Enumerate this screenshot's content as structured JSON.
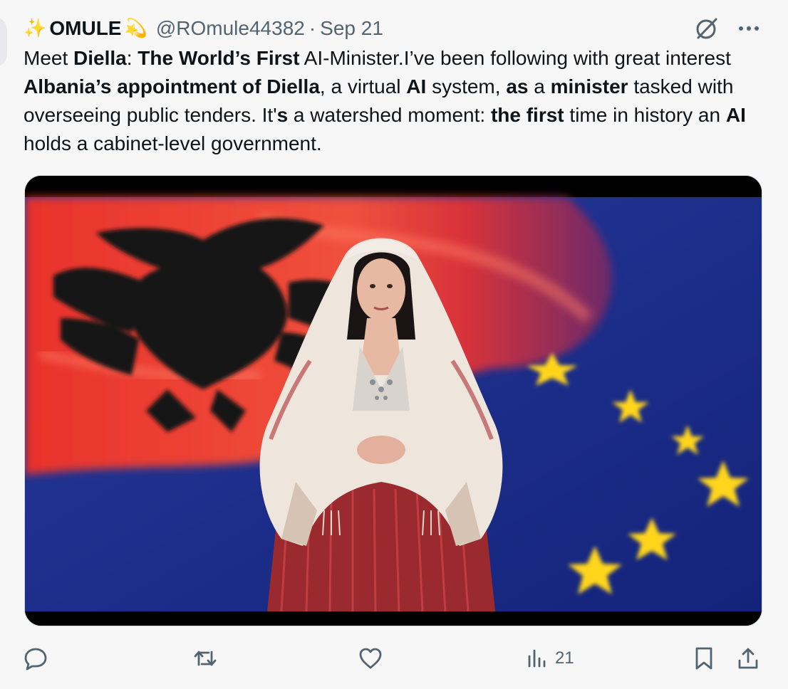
{
  "tweet": {
    "display_name": "OMULE",
    "name_emoji_left": "✨",
    "name_emoji_right": "💫",
    "handle": "@ROmule44382",
    "separator": "·",
    "date": "Sep 21",
    "text": {
      "s1": "Meet ",
      "b1": "Diella",
      "s2": ": ",
      "b2": "The World’s First",
      "s3": " AI-Minister.I’ve been following with great interest ",
      "b3": "Albania’s appointment of Diella",
      "s4": ", a virtual ",
      "b4": "AI",
      "s5": " system, ",
      "b5": "as",
      "s6": " a ",
      "b6": "minister",
      "s7": " tasked with overseeing public tenders. It'",
      "b7": "s",
      "s8": " a watershed moment: ",
      "b8": "the first",
      "s9": " time in history an ",
      "b9": "AI",
      "s10": " holds a cabinet-level government."
    },
    "media": {
      "kind": "video-still",
      "scene": "woman in traditional Albanian dress in front of Albanian and EU flags"
    },
    "actions": {
      "reply_count": "",
      "repost_count": "",
      "like_count": "",
      "views_count": "21"
    },
    "icons": {
      "grok": "grok-icon",
      "more": "more-icon",
      "reply": "reply-icon",
      "repost": "repost-icon",
      "like": "like-icon",
      "views": "views-icon",
      "bookmark": "bookmark-icon",
      "share": "share-icon"
    },
    "colors": {
      "text": "#0f1419",
      "secondary": "#536471",
      "background": "#f7f7f7",
      "flag_red": "#e8322b",
      "eu_blue": "#1d2f8e",
      "eu_star": "#ffd51a"
    }
  }
}
